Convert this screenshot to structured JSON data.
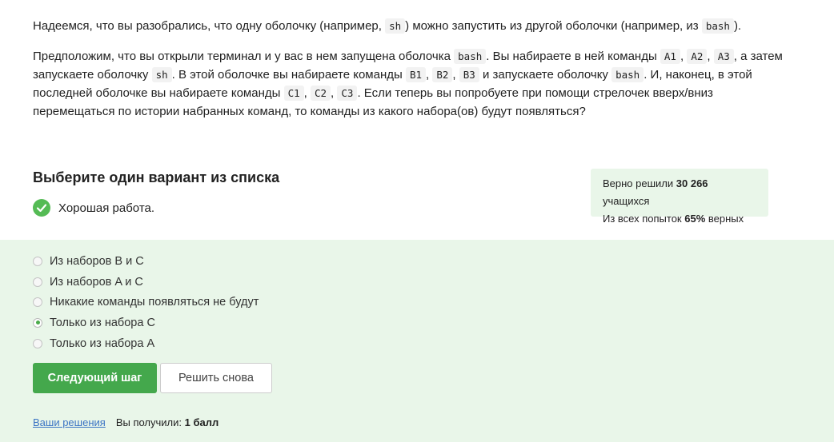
{
  "question": {
    "p1": [
      "Надеемся, что вы разобрались, что одну оболочку (например, ",
      "sh",
      ") можно запустить из другой оболочки (например, из ",
      "bash",
      ")."
    ],
    "p2": [
      "Предположим, что вы открыли терминал и у вас в нем запущена оболочка ",
      "bash",
      ". Вы набираете в ней команды ",
      "A1",
      ", ",
      "A2",
      ", ",
      "A3",
      ", а затем запускаете оболочку ",
      "sh",
      ". В этой оболочке вы набираете команды ",
      "B1",
      ", ",
      "B2",
      ", ",
      "B3",
      " и запускаете оболочку ",
      "bash",
      ". И, наконец, в этой последней оболочке вы набираете команды ",
      "C1",
      ", ",
      "C2",
      ", ",
      "C3",
      ". Если теперь вы попробуете при помощи стрелочек вверх/вниз перемещаться по истории набранных команд, то команды из какого набора(ов) будут появляться?"
    ]
  },
  "prompt_title": "Выберите один вариант из списка",
  "feedback": "Хорошая работа.",
  "stats": {
    "line1_prefix": "Верно решили ",
    "line1_count": "30 266",
    "line1_suffix": " учащихся",
    "line2_prefix": "Из всех попыток ",
    "line2_percent": "65%",
    "line2_suffix": " верных"
  },
  "options": [
    {
      "label": "Из наборов B и C",
      "selected": false
    },
    {
      "label": "Из наборов A и C",
      "selected": false
    },
    {
      "label": "Никакие команды появляться не будут",
      "selected": false
    },
    {
      "label": "Только из набора C",
      "selected": true
    },
    {
      "label": "Только из набора A",
      "selected": false
    }
  ],
  "buttons": {
    "next": "Следующий шаг",
    "retry": "Решить снова"
  },
  "footer": {
    "link": "Ваши решения",
    "score_prefix": "Вы получили: ",
    "score_value": "1 балл"
  },
  "colors": {
    "accent_green": "#44a84c",
    "answer_bg": "#e9f6e9",
    "link_blue": "#3b74c4"
  }
}
